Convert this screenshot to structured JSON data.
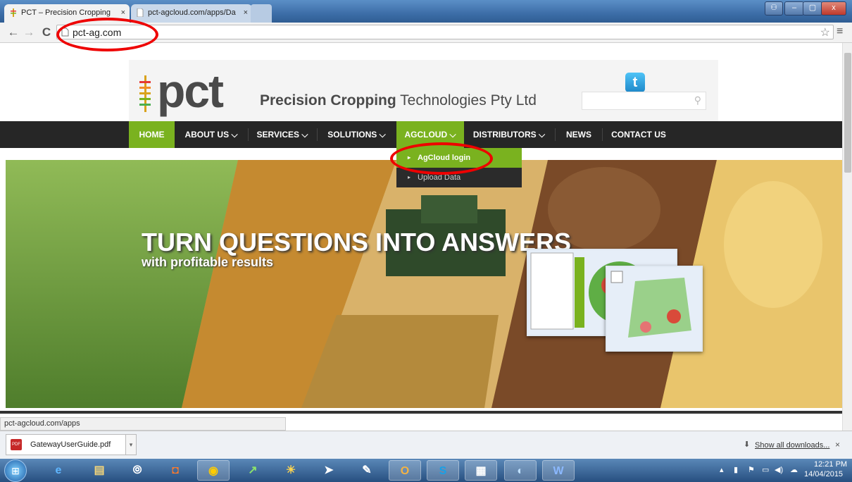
{
  "browser": {
    "tabs": [
      {
        "title": "PCT – Precision Cropping",
        "close": "×"
      },
      {
        "title": "pct-agcloud.com/apps/Da",
        "close": "×"
      }
    ],
    "window_controls": {
      "user": "⚇",
      "minimize": "–",
      "maximize": "▢",
      "close": "x"
    },
    "nav": {
      "back": "←",
      "forward": "→",
      "reload": "C"
    },
    "url": "pct-ag.com",
    "star": "☆",
    "menu": "≡",
    "status_url": "pct-agcloud.com/apps"
  },
  "site": {
    "logo_text": "pct",
    "company_bold": "Precision Cropping",
    "company_rest": " Technologies Pty Ltd",
    "twitter_glyph": "t",
    "search_icon": "⚲",
    "nav": [
      {
        "label": "HOME",
        "active": true
      },
      {
        "label": "ABOUT US ⌵"
      },
      {
        "label": "SERVICES ⌵"
      },
      {
        "label": "SOLUTIONS ⌵"
      },
      {
        "label": "AGCLOUD ⌵",
        "active": true
      },
      {
        "label": "DISTRIBUTORS ⌵"
      },
      {
        "label": "NEWS"
      },
      {
        "label": "CONTACT US"
      }
    ],
    "dropdown": [
      "AgCloud login",
      "Upload Data"
    ],
    "dropdown_arrow": "▸",
    "hero_title": "TURN QUESTIONS INTO ANSWERS",
    "hero_subtitle": "with profitable results"
  },
  "downloads": {
    "file": "GatewayUserGuide.pdf",
    "pdf_icon": "PDF",
    "menu_arrow": "▾",
    "show_all": "Show all downloads...",
    "download_icon": "⬇",
    "close": "×"
  },
  "taskbar": {
    "start_icon": "⊞",
    "apps": [
      "e",
      "▤",
      "⦾",
      "◘",
      "◉",
      "↗",
      "☀",
      "➤",
      "✎",
      "O",
      "S",
      "▦",
      "◐",
      "W"
    ],
    "time": "12:21 PM",
    "date": "14/04/2015",
    "tray_icons": [
      "▴",
      "▮",
      "⚑",
      "▭",
      "◀)",
      "☁"
    ]
  },
  "colors": {
    "accent_green": "#7ab21f",
    "nav_bg": "#262626",
    "annotation_red": "#e00000"
  }
}
